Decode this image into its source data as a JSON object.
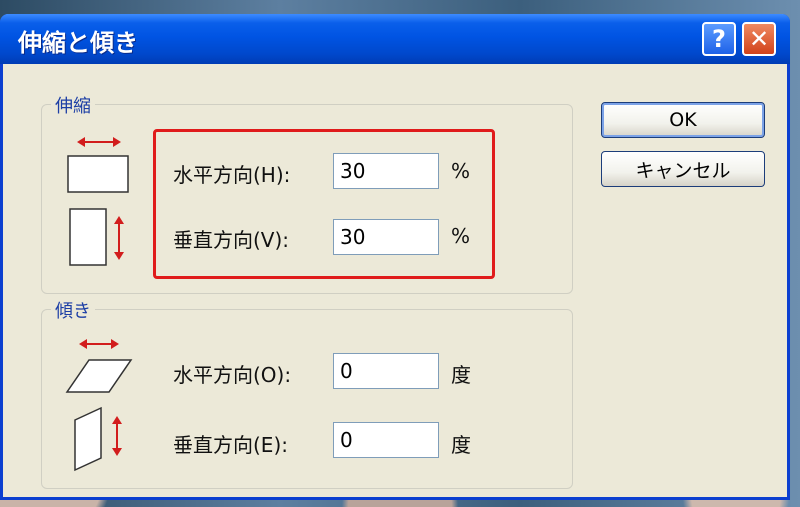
{
  "dialog": {
    "title": "伸縮と傾き",
    "help_label": "?",
    "close_label": "✕"
  },
  "stretch": {
    "group_label": "伸縮",
    "horizontal_label": "水平方向(H):",
    "horizontal_value": "30",
    "horizontal_unit": "%",
    "vertical_label": "垂直方向(V):",
    "vertical_value": "30",
    "vertical_unit": "%"
  },
  "skew": {
    "group_label": "傾き",
    "horizontal_label": "水平方向(O):",
    "horizontal_value": "0",
    "horizontal_unit": "度",
    "vertical_label": "垂直方向(E):",
    "vertical_value": "0",
    "vertical_unit": "度"
  },
  "buttons": {
    "ok_label": "OK",
    "cancel_label": "キャンセル"
  },
  "colors": {
    "title_bar": "#0054e3",
    "highlight": "#e01b1b",
    "group_label": "#1c3ea5"
  }
}
